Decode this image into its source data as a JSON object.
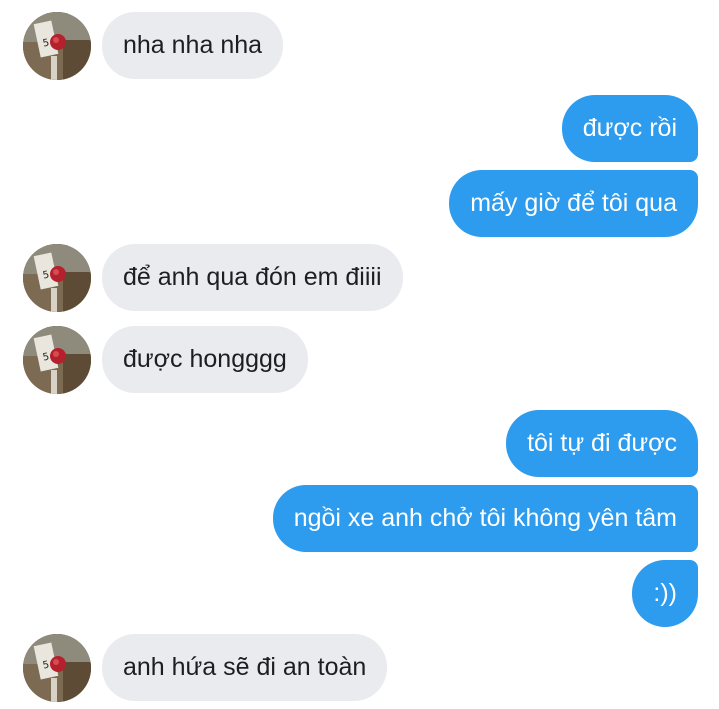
{
  "messages": [
    {
      "direction": "in",
      "text": "nha nha nha",
      "avatar": "avatar-icon"
    },
    {
      "direction": "out",
      "text": "được rồi"
    },
    {
      "direction": "out",
      "text": "mấy giờ để tôi qua"
    },
    {
      "direction": "in",
      "text": "để anh qua đón em điiii",
      "avatar": "avatar-icon"
    },
    {
      "direction": "in",
      "text": "được hongggg",
      "avatar": "avatar-icon"
    },
    {
      "direction": "out",
      "text": "tôi tự đi được"
    },
    {
      "direction": "out",
      "text": "ngồi xe anh chở tôi không yên tâm"
    },
    {
      "direction": "out",
      "text": ":))"
    },
    {
      "direction": "in",
      "text": "anh hứa sẽ đi an toàn",
      "avatar": "avatar-icon"
    }
  ],
  "colors": {
    "incoming_bubble": "#e9ebee",
    "outgoing_bubble": "#2d9bee",
    "incoming_text": "#1c1e21",
    "outgoing_text": "#ffffff"
  }
}
